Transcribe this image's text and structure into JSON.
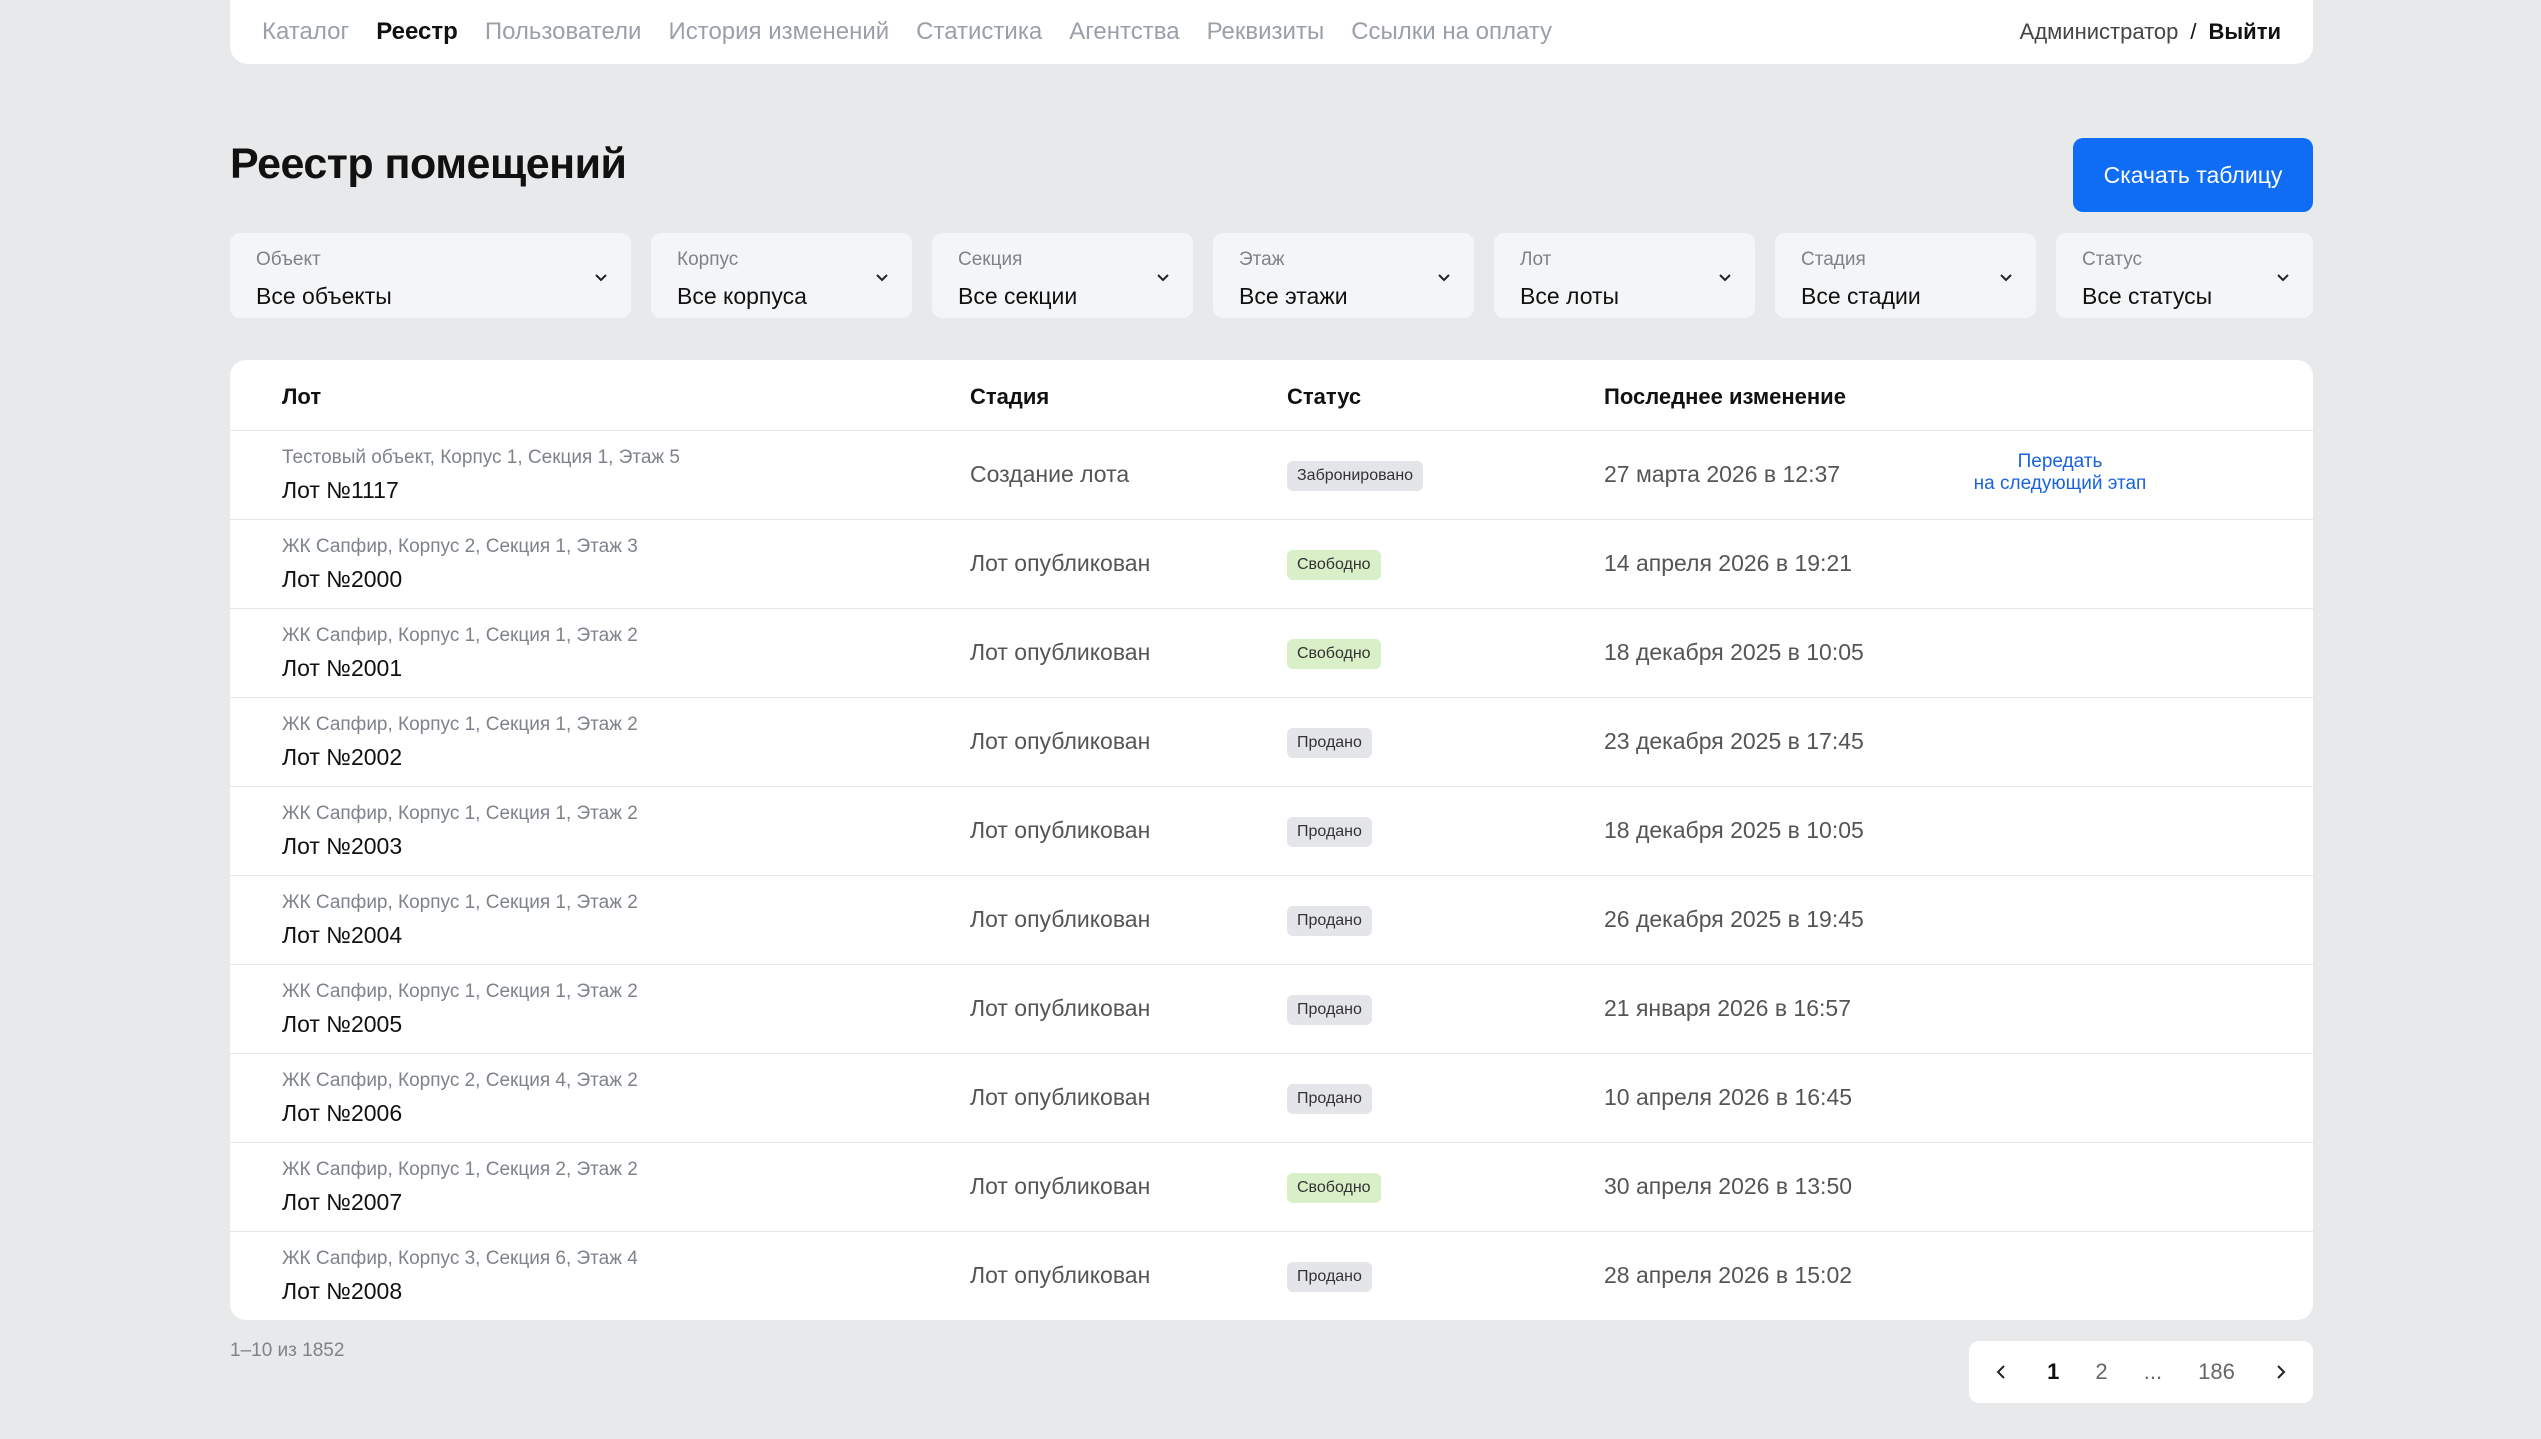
{
  "nav": {
    "items": [
      {
        "label": "Каталог",
        "active": false
      },
      {
        "label": "Реестр",
        "active": true
      },
      {
        "label": "Пользователи",
        "active": false
      },
      {
        "label": "История изменений",
        "active": false
      },
      {
        "label": "Статистика",
        "active": false
      },
      {
        "label": "Агентства",
        "active": false
      },
      {
        "label": "Реквизиты",
        "active": false
      },
      {
        "label": "Ссылки на оплату",
        "active": false
      }
    ],
    "user": "Администратор",
    "separator": "/",
    "logout": "Выйти"
  },
  "page": {
    "title": "Реестр помещений",
    "download_label": "Скачать таблицу"
  },
  "filters": [
    {
      "label": "Объект",
      "value": "Все объекты"
    },
    {
      "label": "Корпус",
      "value": "Все корпуса"
    },
    {
      "label": "Секция",
      "value": "Все секции"
    },
    {
      "label": "Этаж",
      "value": "Все этажи"
    },
    {
      "label": "Лот",
      "value": "Все лоты"
    },
    {
      "label": "Стадия",
      "value": "Все стадии"
    },
    {
      "label": "Статус",
      "value": "Все статусы"
    }
  ],
  "table": {
    "headers": {
      "lot": "Лот",
      "stage": "Стадия",
      "status": "Статус",
      "changed": "Последнее изменение"
    },
    "rows": [
      {
        "addr": "Тестовый объект, Корпус 1, Секция 1, Этаж 5",
        "lot": "Лот №1117",
        "stage": "Создание лота",
        "status": "Забронировано",
        "status_kind": "gray",
        "date": "27 марта 2026 в 12:37",
        "action_line1": "Передать",
        "action_line2": "на следующий этап"
      },
      {
        "addr": "ЖК Сапфир, Корпус 2, Секция 1, Этаж 3",
        "lot": "Лот №2000",
        "stage": "Лот опубликован",
        "status": "Свободно",
        "status_kind": "free",
        "date": "14 апреля 2026 в 19:21"
      },
      {
        "addr": "ЖК Сапфир, Корпус 1, Секция 1, Этаж 2",
        "lot": "Лот №2001",
        "stage": "Лот опубликован",
        "status": "Свободно",
        "status_kind": "free",
        "date": "18 декабря 2025 в 10:05"
      },
      {
        "addr": "ЖК Сапфир, Корпус 1, Секция 1, Этаж 2",
        "lot": "Лот №2002",
        "stage": "Лот опубликован",
        "status": "Продано",
        "status_kind": "gray",
        "date": "23 декабря 2025 в 17:45"
      },
      {
        "addr": "ЖК Сапфир, Корпус 1, Секция 1, Этаж 2",
        "lot": "Лот №2003",
        "stage": "Лот опубликован",
        "status": "Продано",
        "status_kind": "gray",
        "date": "18 декабря 2025 в 10:05"
      },
      {
        "addr": "ЖК Сапфир, Корпус 1, Секция 1, Этаж 2",
        "lot": "Лот №2004",
        "stage": "Лот опубликован",
        "status": "Продано",
        "status_kind": "gray",
        "date": "26 декабря 2025 в 19:45"
      },
      {
        "addr": "ЖК Сапфир, Корпус 1, Секция 1, Этаж 2",
        "lot": "Лот №2005",
        "stage": "Лот опубликован",
        "status": "Продано",
        "status_kind": "gray",
        "date": "21 января 2026 в 16:57"
      },
      {
        "addr": "ЖК Сапфир, Корпус 2, Секция 4, Этаж 2",
        "lot": "Лот №2006",
        "stage": "Лот опубликован",
        "status": "Продано",
        "status_kind": "gray",
        "date": "10 апреля 2026 в 16:45"
      },
      {
        "addr": "ЖК Сапфир, Корпус 1, Секция 2, Этаж 2",
        "lot": "Лот №2007",
        "stage": "Лот опубликован",
        "status": "Свободно",
        "status_kind": "free",
        "date": "30 апреля 2026 в 13:50"
      },
      {
        "addr": "ЖК Сапфир, Корпус 3, Секция 6, Этаж 4",
        "lot": "Лот №2008",
        "stage": "Лот опубликован",
        "status": "Продано",
        "status_kind": "gray",
        "date": "28 апреля 2026 в 15:02"
      }
    ]
  },
  "pagination": {
    "range": "1–10 из 1852",
    "pages": [
      "1",
      "2",
      "...",
      "186"
    ],
    "current": "1"
  },
  "colors": {
    "accent": "#0f6cf5",
    "link": "#1a63e0",
    "free_badge": "#d9efc7",
    "gray_badge": "#e4e5e8",
    "background": "#e8e9eb"
  }
}
